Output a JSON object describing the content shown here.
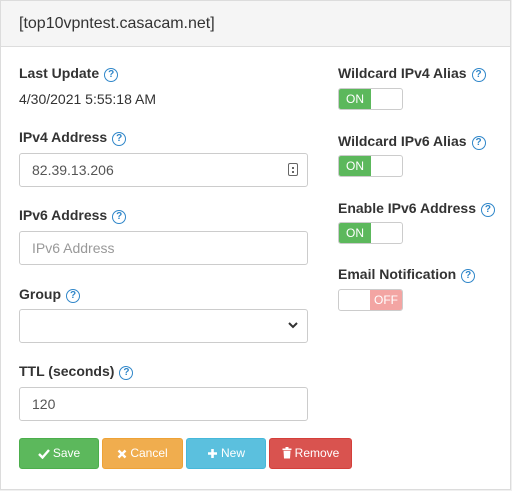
{
  "header": {
    "title": "[top10vpntest.casacam.net]"
  },
  "help_glyph": "?",
  "fields": {
    "last_update": {
      "label": "Last Update",
      "value": "4/30/2021 5:55:18 AM"
    },
    "ipv4": {
      "label": "IPv4 Address",
      "value": "82.39.13.206"
    },
    "ipv6": {
      "label": "IPv6 Address",
      "value": "",
      "placeholder": "IPv6 Address"
    },
    "group": {
      "label": "Group",
      "value": ""
    },
    "ttl": {
      "label": "TTL (seconds)",
      "value": "120"
    }
  },
  "toggles": {
    "wildcard_ipv4": {
      "label": "Wildcard IPv4 Alias",
      "state": "ON"
    },
    "wildcard_ipv6": {
      "label": "Wildcard IPv6 Alias",
      "state": "ON"
    },
    "enable_ipv6": {
      "label": "Enable IPv6 Address",
      "state": "ON"
    },
    "email_notification": {
      "label": "Email Notification",
      "state": "OFF"
    }
  },
  "buttons": {
    "save": "Save",
    "cancel": "Cancel",
    "new": "New",
    "remove": "Remove"
  },
  "colors": {
    "on": "#5cb85c",
    "off": "#f3a5a3",
    "help": "#2f86c9",
    "save": "#5cb85c",
    "cancel": "#f0ad4e",
    "new": "#5bc0de",
    "remove": "#d9534f"
  }
}
